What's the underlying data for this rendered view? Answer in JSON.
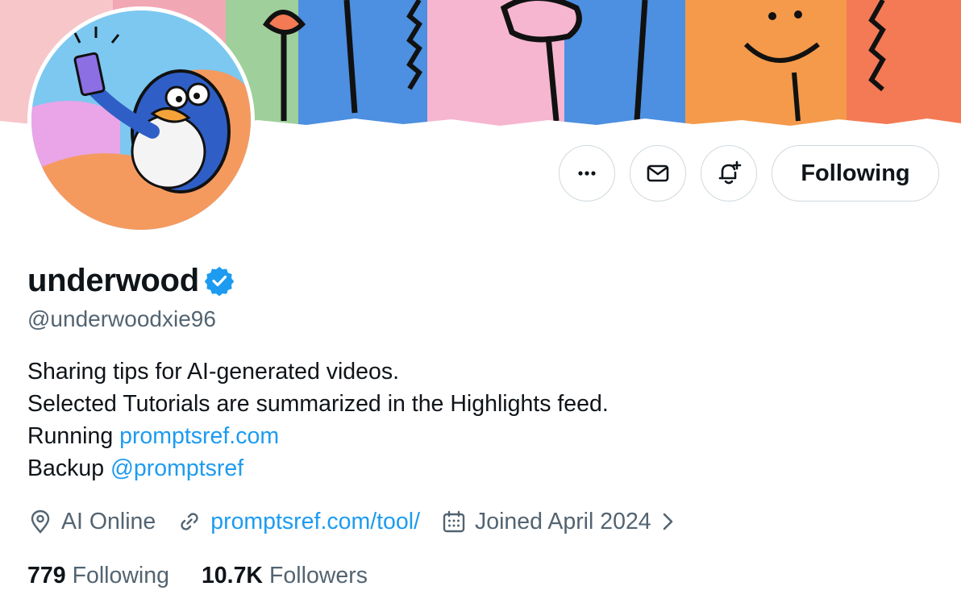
{
  "profile": {
    "display_name": "underwood",
    "handle": "@underwoodxie96",
    "bio": {
      "line1": "Sharing tips for AI-generated videos.",
      "line2": "Selected Tutorials are summarized in the Highlights feed.",
      "line3_prefix": "Running ",
      "line3_link": "promptsref.com",
      "line4_prefix": "Backup ",
      "line4_link": "@promptsref"
    },
    "location": "AI Online",
    "website": "promptsref.com/tool/",
    "joined": "Joined April 2024",
    "following_count": "779",
    "following_label": "Following",
    "followers_count": "10.7K",
    "followers_label": "Followers"
  },
  "actions": {
    "more_icon": "more-horizontal-icon",
    "message_icon": "envelope-icon",
    "notify_icon": "bell-plus-icon",
    "follow_label": "Following"
  },
  "icons": {
    "verified": "verified-badge-icon",
    "location": "location-pin-icon",
    "link": "link-icon",
    "calendar": "calendar-icon",
    "chevron": "chevron-right-icon"
  },
  "colors": {
    "link": "#1d9bf0",
    "secondary_text": "#536471",
    "primary_text": "#0f1419",
    "border": "#cfd9de",
    "verified": "#1d9bf0"
  }
}
